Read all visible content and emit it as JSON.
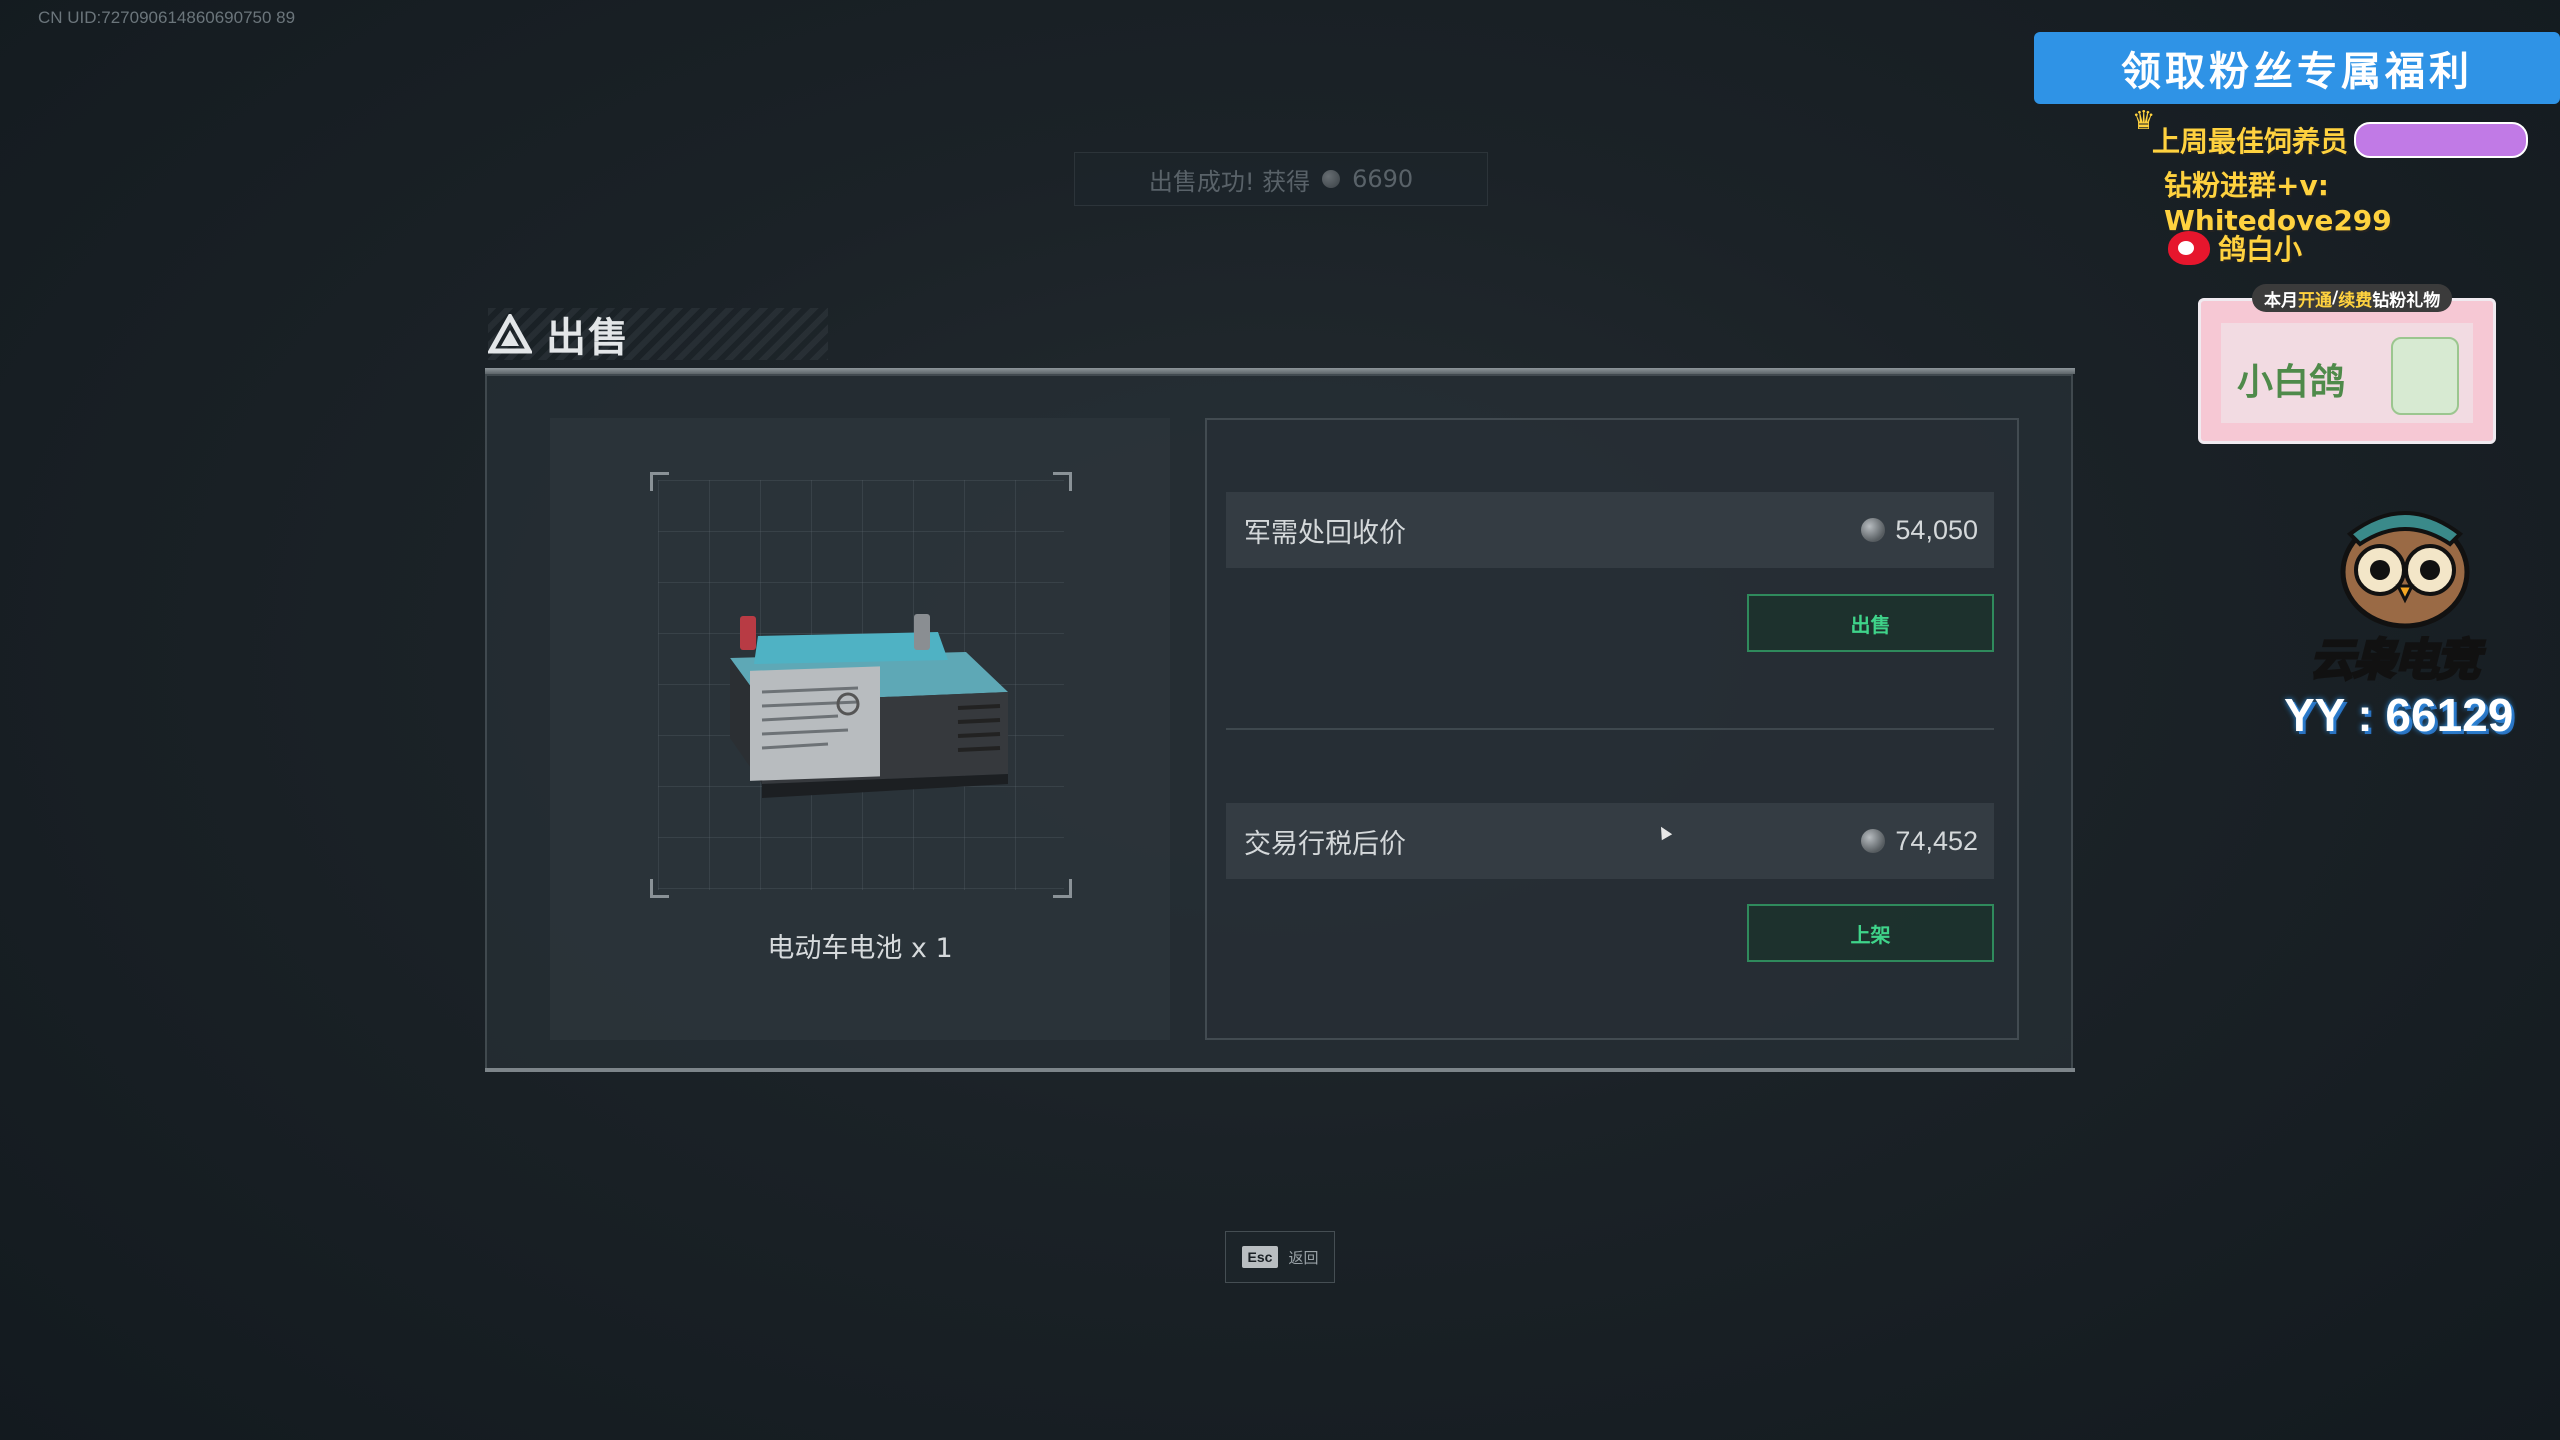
{
  "uid": "CN UID:727090614860690750 89",
  "toast": {
    "text": "出售成功! 获得",
    "amount": "6690"
  },
  "dialog": {
    "title": "出售",
    "item_name": "电动车电池 x 1",
    "rows": [
      {
        "label": "军需处回收价",
        "value": "54,050",
        "button": "出售"
      },
      {
        "label": "交易行税后价",
        "value": "74,452",
        "button": "上架"
      }
    ]
  },
  "esc": {
    "key": "Esc",
    "label": "返回"
  },
  "overlay": {
    "banner": "领取粉丝专属福利",
    "feeder_label": "上周最佳饲养员",
    "diamond_line": "钻粉进群+v: Whitedove299",
    "weibo_name": "鸽白小",
    "gift_tag_prefix": "本月",
    "gift_tag_open": "开通",
    "gift_tag_slash": "/",
    "gift_tag_renew": "续费",
    "gift_tag_suffix": "钻粉礼物",
    "gift_logo": "小白鸽",
    "brand": "云枭电竞",
    "yy": "YY : 66129"
  }
}
